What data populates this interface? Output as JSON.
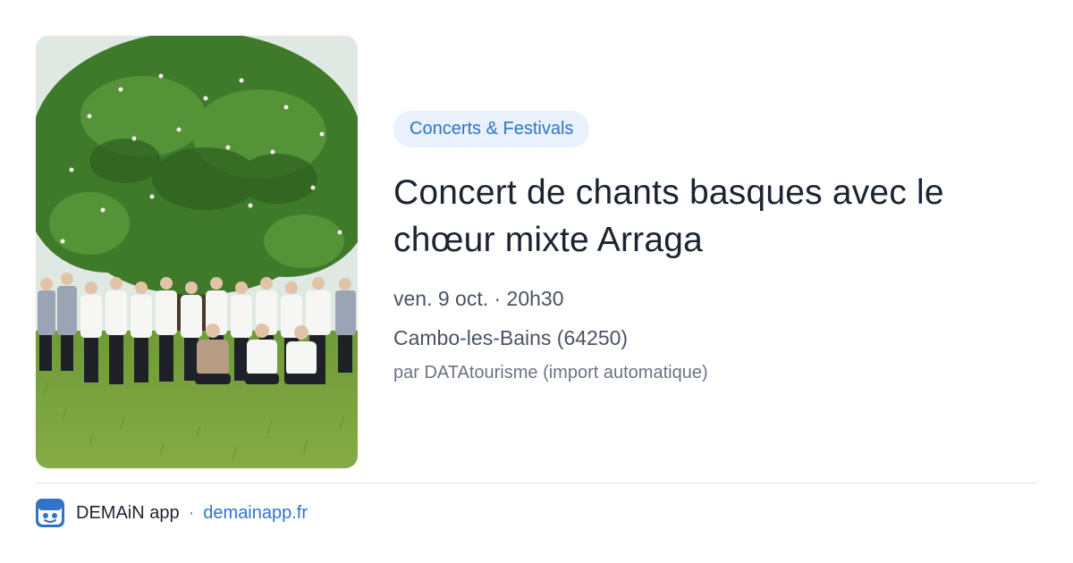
{
  "event": {
    "category": "Concerts & Festivals",
    "title": "Concert de chants basques avec le chœur mixte Arraga",
    "datetime": "ven. 9 oct. · 20h30",
    "location": "Cambo-les-Bains (64250)",
    "source": "par DATAtourisme (import automatique)"
  },
  "footer": {
    "app_name": "DEMAiN app",
    "separator": "·",
    "url": "demainapp.fr",
    "logo_icon": "app-logo-icon"
  },
  "colors": {
    "accent": "#2f74c8",
    "tag_background": "#e8f1fc",
    "title": "#1c2431",
    "meta": "#4a5363",
    "divider": "#dde2e8"
  }
}
